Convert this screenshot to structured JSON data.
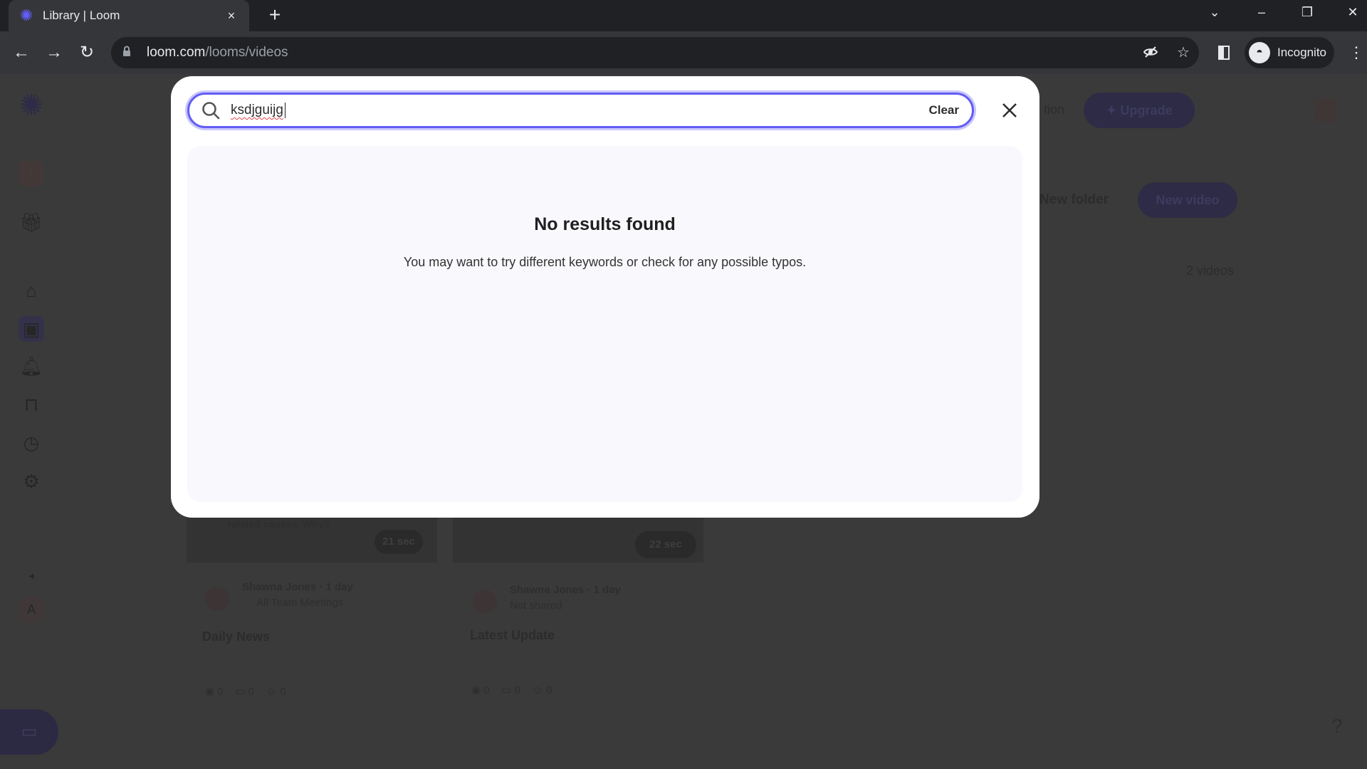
{
  "browser": {
    "tab": {
      "title": "Library | Loom",
      "favicon": "loom-logo-icon",
      "close": "×"
    },
    "new_tab": "+",
    "window_controls": {
      "tab_search": "⌄",
      "minimize": "–",
      "restore": "❐",
      "close": "✕"
    },
    "nav": {
      "back": "←",
      "forward": "→",
      "reload": "↻"
    },
    "url": {
      "host": "loom.com",
      "path": "/looms/videos"
    },
    "incognito_label": "Incognito",
    "menu": "⋮"
  },
  "search_modal": {
    "query": "ksdjguijg",
    "clear_label": "Clear",
    "close_label": "✕",
    "empty_title": "No results found",
    "empty_message": "You may want to try different keywords or check for any possible typos."
  },
  "background": {
    "header": {
      "upgrade_label": "Upgrade",
      "partial_link": "tion"
    },
    "actions": {
      "new_folder": "New folder",
      "new_video": "New video"
    },
    "video_count": "2 videos",
    "sidebar_avatar": "T",
    "footer_avatar": "A",
    "videos": [
      {
        "title": "Daily News",
        "author": "Shawna Jones",
        "age": "1 day",
        "location": "All Team Meetings",
        "duration": "21 sec",
        "thumb_caption": "related causes. Why?",
        "views": "0",
        "comments": "0",
        "reactions": "0"
      },
      {
        "title": "Latest Update",
        "author": "Shawna Jones",
        "age": "1 day",
        "location": "Not shared",
        "duration": "22 sec",
        "views": "0",
        "comments": "0",
        "reactions": "0"
      }
    ],
    "help": "?"
  }
}
